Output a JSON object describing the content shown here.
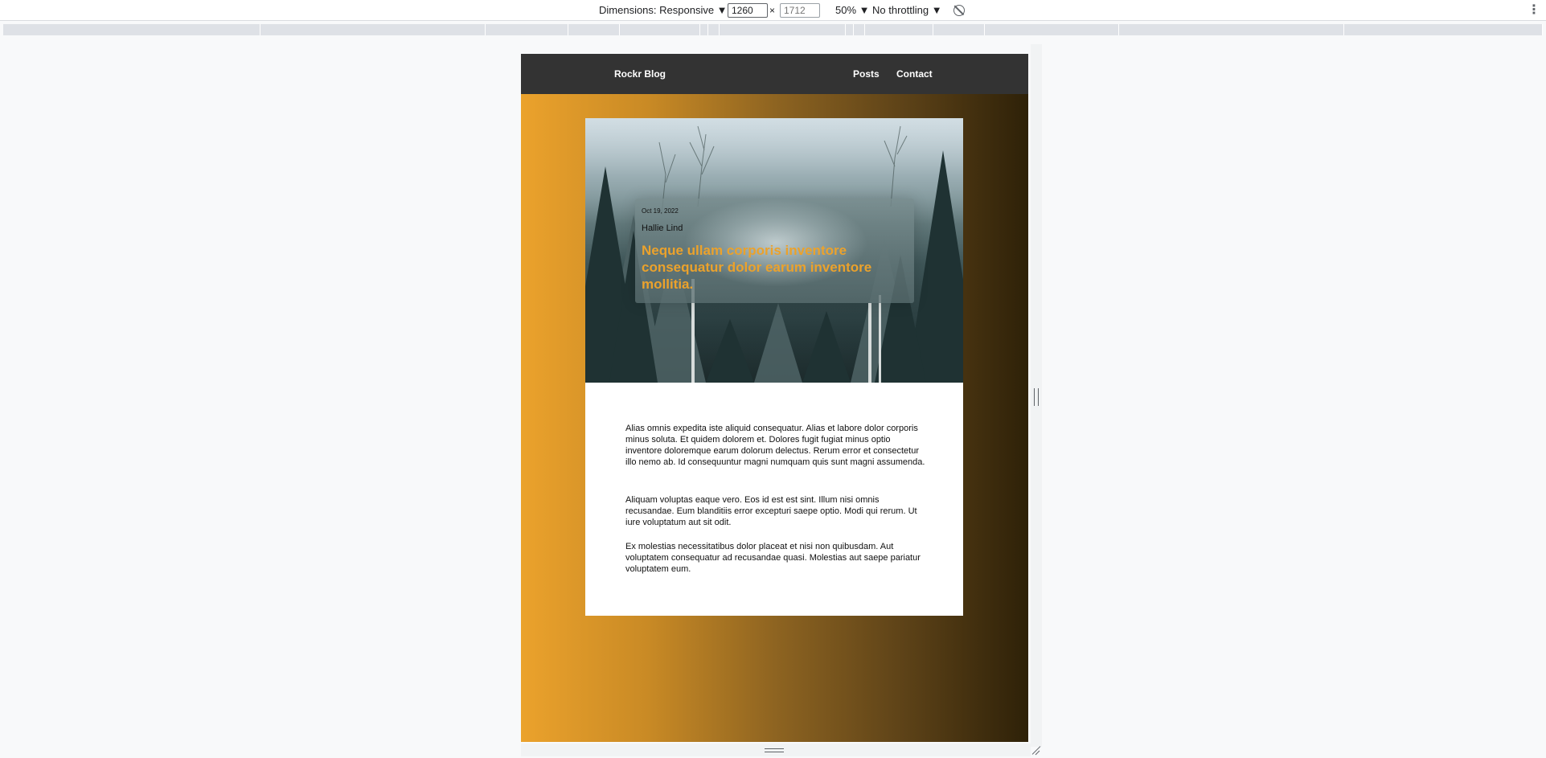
{
  "devtools": {
    "dimensions_label": "Dimensions: Responsive ▼",
    "width_value": "1260",
    "height_placeholder": "1712",
    "times": "×",
    "zoom": "50% ▼",
    "throttling": "No throttling ▼",
    "more_icon": "⋮"
  },
  "site": {
    "brand": "Rockr Blog",
    "nav": {
      "posts": "Posts",
      "contact": "Contact"
    },
    "colors": {
      "accent": "#eba22c",
      "header_bg": "#333333",
      "gradient_end": "#2e2108"
    }
  },
  "post": {
    "date": "Oct 19, 2022",
    "author": "Hallie Lind",
    "title": "Neque ullam corporis inventore consequatur dolor earum inventore mollitia.",
    "paragraphs": [
      "Alias omnis expedita iste aliquid consequatur. Alias et labore dolor corporis minus soluta. Et quidem dolorem et. Dolores fugit fugiat minus optio inventore doloremque earum dolorum delectus. Rerum error et consectetur illo nemo ab. Id consequuntur magni numquam quis sunt magni assumenda.",
      "Aliquam voluptas eaque vero. Eos id est est sint. Illum nisi omnis recusandae. Eum blanditiis error excepturi saepe optio. Modi qui rerum. Ut iure voluptatum aut sit odit.",
      "Ex molestias necessitatibus dolor placeat et nisi non quibusdam. Aut voluptatem consequatur ad recusandae quasi. Molestias aut saepe pariatur voluptatem eum."
    ]
  }
}
